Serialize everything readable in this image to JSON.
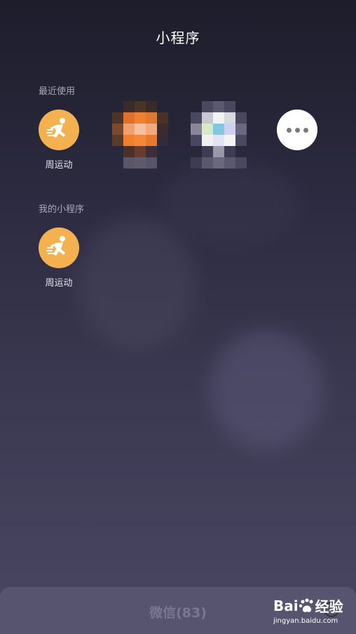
{
  "header": {
    "title": "小程序"
  },
  "recent": {
    "label": "最近使用",
    "apps": [
      {
        "name": "周运动",
        "icon": "running-man-icon"
      },
      {
        "name": "",
        "icon": "pixelated-app-icon"
      },
      {
        "name": "",
        "icon": "pixelated-app-icon"
      }
    ],
    "more_icon": "more-dots-icon"
  },
  "mine": {
    "label": "我的小程序",
    "apps": [
      {
        "name": "周运动",
        "icon": "running-man-icon"
      }
    ]
  },
  "bottom": {
    "title": "微信(83)"
  },
  "watermark": {
    "brand_a": "Bai",
    "brand_b": "经验",
    "url": "jingyan.baidu.com"
  },
  "colors": {
    "accent_orange": "#f3b24f",
    "bg_bottom": "#57546f"
  }
}
